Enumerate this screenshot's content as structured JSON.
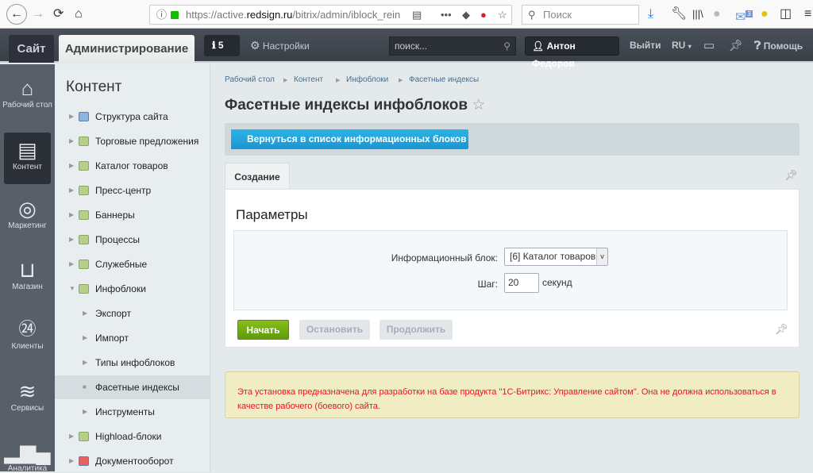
{
  "browser": {
    "url_prefix": "https://active.",
    "url_domain": "redsign.ru",
    "url_path": "/bitrix/admin/iblock_rein",
    "search_placeholder": "Поиск",
    "mail_badge": "3"
  },
  "header": {
    "site_tab": "Сайт",
    "admin_tab": "Администрирование",
    "notifications": "5",
    "settings": "Настройки",
    "search_placeholder": "поиск...",
    "user": "Антон Федоров",
    "logout": "Выйти",
    "lang": "RU",
    "help": "Помощь"
  },
  "leftbar": [
    {
      "label": "Рабочий стол",
      "icon": "home-icon"
    },
    {
      "label": "Контент",
      "icon": "document-icon"
    },
    {
      "label": "Маркетинг",
      "icon": "target-icon"
    },
    {
      "label": "Магазин",
      "icon": "basket-icon"
    },
    {
      "label": "Клиенты",
      "icon": "clients-24-icon"
    },
    {
      "label": "Сервисы",
      "icon": "layers-icon"
    },
    {
      "label": "Аналитика",
      "icon": "chart-icon"
    }
  ],
  "menu": {
    "title": "Контент",
    "items": [
      {
        "label": "Структура сайта",
        "level": 0
      },
      {
        "label": "Торговые предложения",
        "level": 0
      },
      {
        "label": "Каталог товаров",
        "level": 0
      },
      {
        "label": "Пресс-центр",
        "level": 0
      },
      {
        "label": "Баннеры",
        "level": 0
      },
      {
        "label": "Процессы",
        "level": 0
      },
      {
        "label": "Служебные",
        "level": 0
      },
      {
        "label": "Инфоблоки",
        "level": 0
      },
      {
        "label": "Экспорт",
        "level": 1
      },
      {
        "label": "Импорт",
        "level": 1
      },
      {
        "label": "Типы инфоблоков",
        "level": 1
      },
      {
        "label": "Фасетные индексы",
        "level": 1
      },
      {
        "label": "Инструменты",
        "level": 1
      },
      {
        "label": "Highload-блоки",
        "level": 0
      },
      {
        "label": "Документооборот",
        "level": 0
      }
    ]
  },
  "breadcrumb": [
    "Рабочий стол",
    "Контент",
    "Инфоблоки",
    "Фасетные индексы"
  ],
  "page": {
    "title": "Фасетные индексы инфоблоков",
    "back_button": "Вернуться в список информационных блоков",
    "tab": "Создание",
    "section": "Параметры",
    "iblock_label": "Информационный блок:",
    "iblock_value": "[6] Каталог товаров",
    "step_label": "Шаг:",
    "step_value": "20",
    "step_unit": "секунд",
    "start": "Начать",
    "stop": "Остановить",
    "continue": "Продолжить",
    "warning": "Эта установка предназначена для разработки на базе продукта \"1С-Битрикс: Управление сайтом\". Она не должна использоваться в качестве рабочего (боевого) сайта."
  }
}
